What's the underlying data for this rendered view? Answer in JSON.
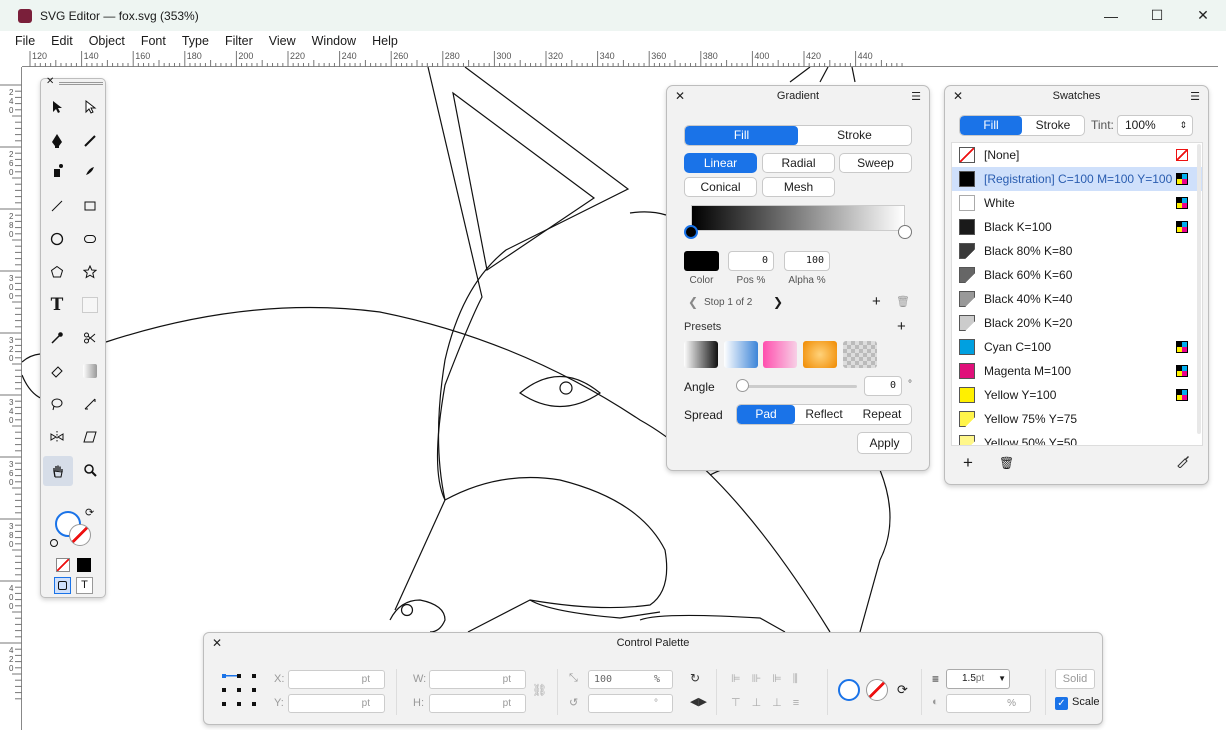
{
  "window": {
    "title": "SVG Editor — fox.svg (353%)",
    "min": "—",
    "max": "☐",
    "close": "✕"
  },
  "menu": [
    "File",
    "Edit",
    "Object",
    "Font",
    "Type",
    "Filter",
    "View",
    "Window",
    "Help"
  ],
  "ruler": {
    "h_ticks": [
      "120",
      "140",
      "160",
      "180",
      "200",
      "220",
      "240",
      "260",
      "280",
      "300",
      "320",
      "340",
      "360",
      "380",
      "400",
      "420",
      "440"
    ],
    "v_ticks": [
      "2\n4\n0",
      "2\n6\n0",
      "2\n8\n0",
      "3\n0\n0",
      "3\n2\n0",
      "3\n4\n0",
      "3\n6\n0",
      "3\n8\n0",
      "4\n0\n0",
      "4\n2\n0"
    ]
  },
  "gradient": {
    "title": "Gradient",
    "fill": "Fill",
    "stroke": "Stroke",
    "types": [
      "Linear",
      "Radial",
      "Sweep",
      "Conical",
      "Mesh"
    ],
    "color_label": "Color",
    "pos_value": "0",
    "pos_label": "Pos %",
    "alpha_value": "100",
    "alpha_label": "Alpha %",
    "stop_text": "Stop 1 of 2",
    "presets_label": "Presets",
    "angle_label": "Angle",
    "angle_value": "0",
    "angle_unit": "°",
    "spread_label": "Spread",
    "spread": [
      "Pad",
      "Reflect",
      "Repeat"
    ],
    "apply": "Apply"
  },
  "swatches": {
    "title": "Swatches",
    "fill": "Fill",
    "stroke": "Stroke",
    "tint_label": "Tint:",
    "tint_value": "100%",
    "items": [
      {
        "name": "[None]",
        "color": "#ffffff"
      },
      {
        "name": "[Registration] C=100 M=100 Y=100",
        "color": "#000000"
      },
      {
        "name": "White",
        "color": "#ffffff"
      },
      {
        "name": "Black K=100",
        "color": "#1a1a1a"
      },
      {
        "name": "Black 80% K=80",
        "color": "#3a3a3a"
      },
      {
        "name": "Black 60% K=60",
        "color": "#666666"
      },
      {
        "name": "Black 40% K=40",
        "color": "#999999"
      },
      {
        "name": "Black 20% K=20",
        "color": "#cccccc"
      },
      {
        "name": "Cyan C=100",
        "color": "#00a0e0"
      },
      {
        "name": "Magenta M=100",
        "color": "#e0107a"
      },
      {
        "name": "Yellow Y=100",
        "color": "#fff000"
      },
      {
        "name": "Yellow 75% Y=75",
        "color": "#fff44a"
      },
      {
        "name": "Yellow 50% Y=50",
        "color": "#fff78a"
      }
    ]
  },
  "control": {
    "title": "Control Palette",
    "x_label": "X:",
    "y_label": "Y:",
    "w_label": "W:",
    "h_label": "H:",
    "unit": "pt",
    "scale_value": "100",
    "pct": "%",
    "deg": "°",
    "stroke_value": "1.5",
    "stroke_unit": "pt",
    "solid": "Solid",
    "scale_label": "Scale"
  }
}
